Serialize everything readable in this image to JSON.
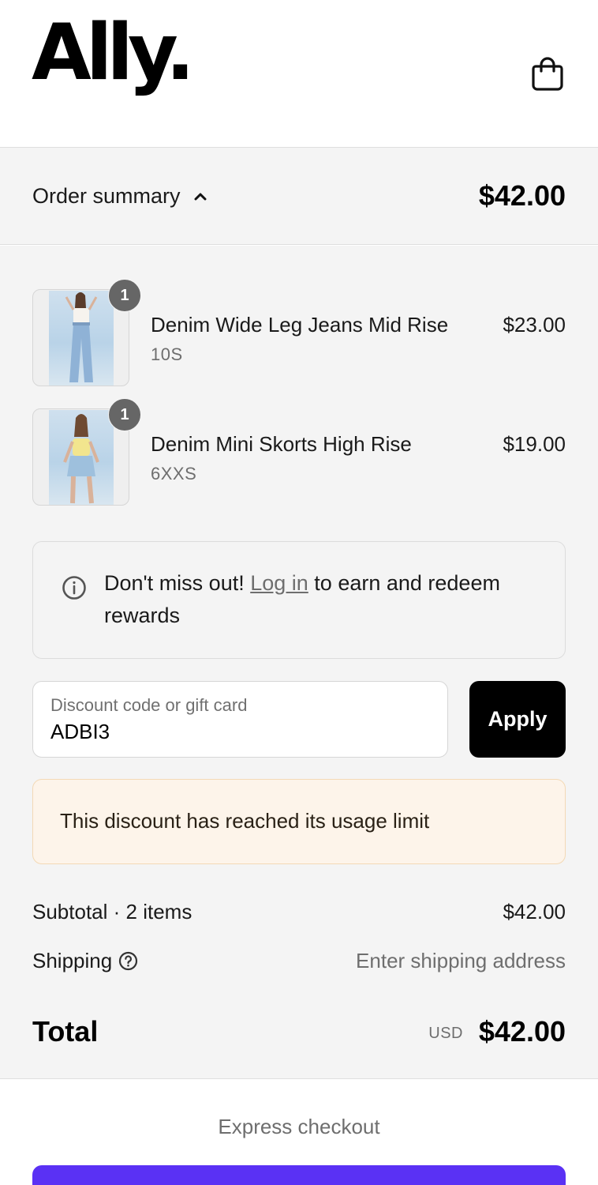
{
  "header": {
    "logo_text": "Ally.",
    "cart_icon": "shopping-bag-icon"
  },
  "summary": {
    "toggle_label": "Order summary",
    "toggle_icon": "chevron-up-icon",
    "total": "$42.00"
  },
  "items": [
    {
      "quantity": "1",
      "name": "Denim Wide Leg Jeans Mid Rise",
      "variant": "10S",
      "price": "$23.00"
    },
    {
      "quantity": "1",
      "name": "Denim Mini Skorts High Rise",
      "variant": "6XXS",
      "price": "$19.00"
    }
  ],
  "rewards": {
    "icon": "info-icon",
    "prefix": "Don't miss out! ",
    "link": "Log in",
    "suffix": " to earn and redeem rewards"
  },
  "discount": {
    "label": "Discount code or gift card",
    "value": "ADBI3",
    "apply_label": "Apply",
    "error": "This discount has reached its usage limit"
  },
  "totals": {
    "subtotal_label": "Subtotal · 2 items",
    "subtotal_value": "$42.00",
    "shipping_label": "Shipping",
    "shipping_icon": "question-circle-icon",
    "shipping_value": "Enter shipping address",
    "total_label": "Total",
    "currency": "USD",
    "total_value": "$42.00"
  },
  "express": {
    "label": "Express checkout",
    "button_color": "#5a31f4"
  },
  "colors": {
    "accent": "#000000",
    "muted_text": "#6e6e6e",
    "panel_bg": "#f4f4f4",
    "warning_bg": "#fdf4ea"
  }
}
